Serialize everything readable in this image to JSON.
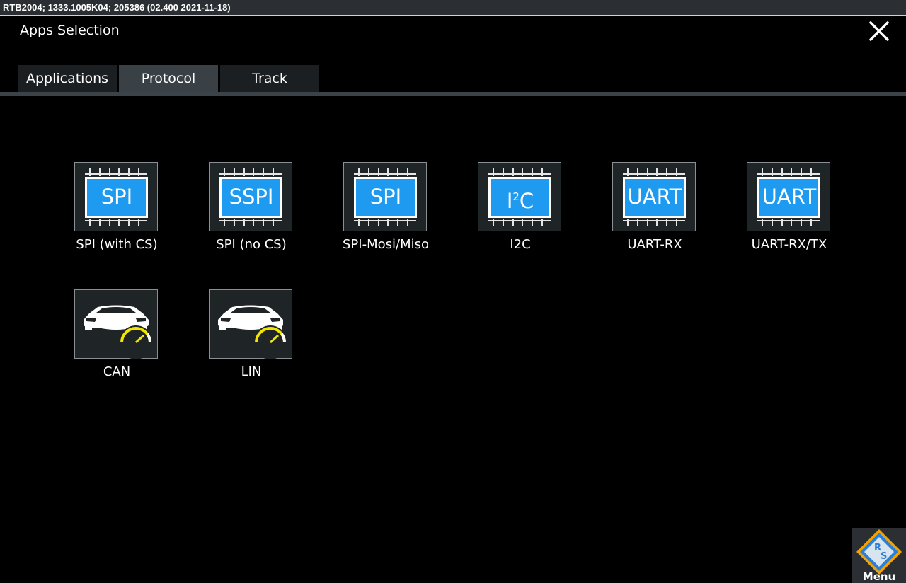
{
  "titlebar": {
    "text": "RTB2004; 1333.1005K04; 205386 (02.400 2021-11-18)"
  },
  "dialog": {
    "title": "Apps Selection"
  },
  "tabs": [
    {
      "label": "Applications",
      "active": false
    },
    {
      "label": "Protocol",
      "active": true
    },
    {
      "label": "Track",
      "active": false
    }
  ],
  "apps": [
    {
      "icon": "spi-chip-icon",
      "chip_text": "SPI",
      "label": "SPI (with CS)"
    },
    {
      "icon": "sspi-chip-icon",
      "chip_text": "SSPI",
      "label": "SPI (no CS)"
    },
    {
      "icon": "spi-chip-icon",
      "chip_text": "SPI",
      "label": "SPI-Mosi/Miso"
    },
    {
      "icon": "i2c-chip-icon",
      "chip_text": "I",
      "chip_sup": "2",
      "chip_suffix": "C",
      "label": "I2C"
    },
    {
      "icon": "uart-chip-icon",
      "chip_text": "UART",
      "label": "UART-RX"
    },
    {
      "icon": "uart-chip-icon",
      "chip_text": "UART",
      "label": "UART-RX/TX"
    },
    {
      "icon": "car-speedometer-icon",
      "label": "CAN"
    },
    {
      "icon": "car-speedometer-icon",
      "label": "LIN"
    }
  ],
  "menu": {
    "label": "Menu",
    "logo_letters": [
      "R",
      "S"
    ]
  },
  "colors": {
    "chip_blue": "#1e9bf0",
    "gauge_yellow": "#f2e600",
    "tile_bg": "#1f2427",
    "active_tab": "#394147"
  }
}
